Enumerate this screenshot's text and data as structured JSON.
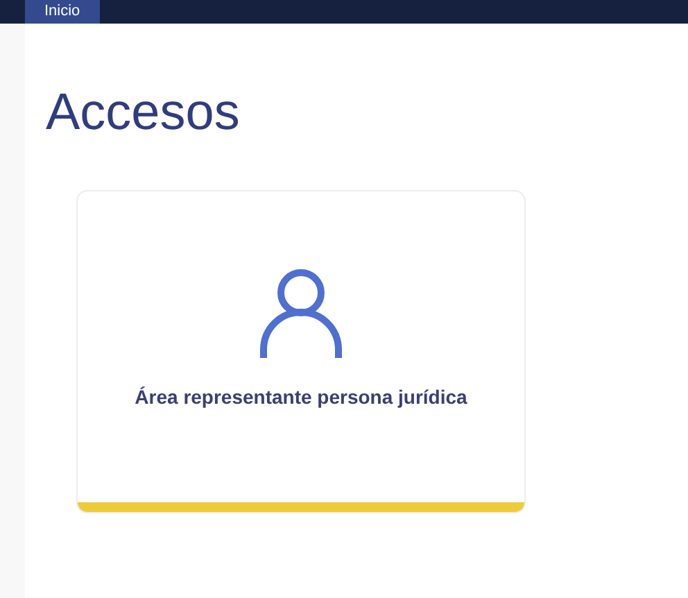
{
  "nav": {
    "tabs": [
      {
        "label": "Inicio",
        "selected": true
      }
    ]
  },
  "page": {
    "title": "Accesos"
  },
  "cards": [
    {
      "label": "Área representante persona jurídica",
      "color": "#eecb3a"
    }
  ]
}
